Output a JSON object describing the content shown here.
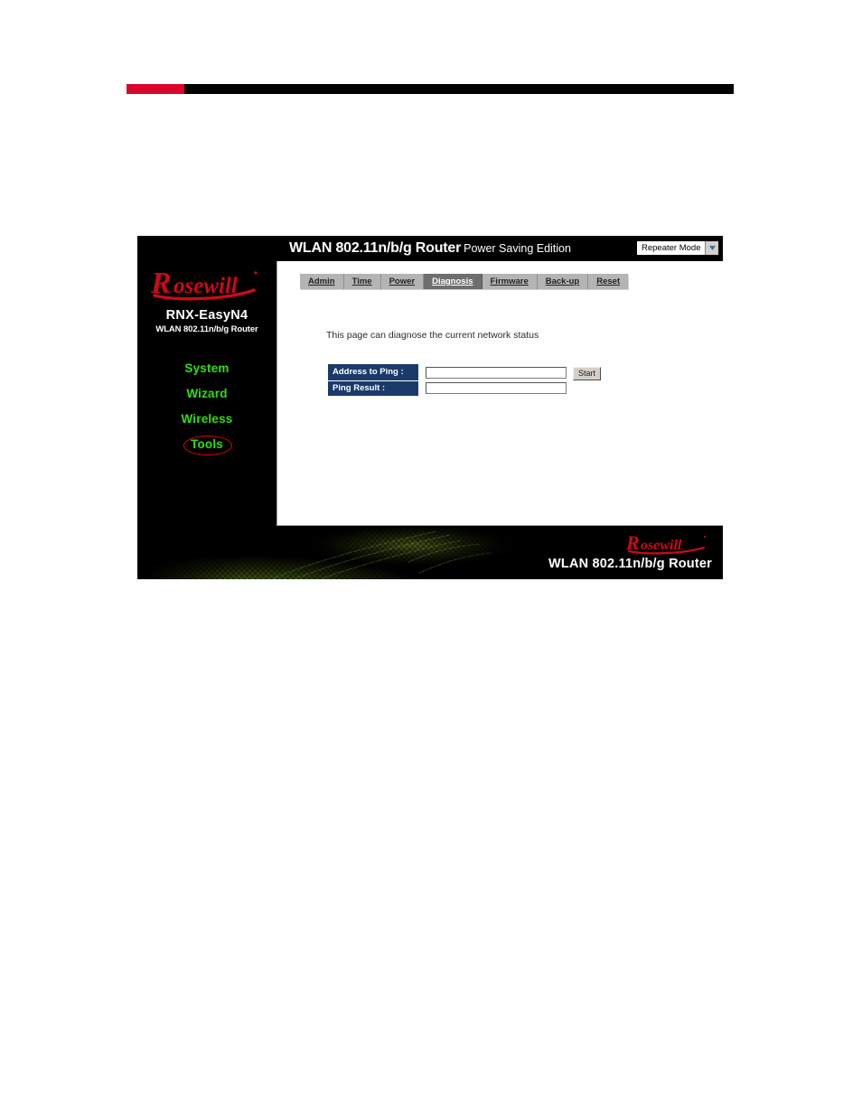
{
  "document": {
    "header_rule": {
      "accent_color": "#d9052b",
      "bar_color": "#000000"
    }
  },
  "router_ui": {
    "titlebar": {
      "title_main": "WLAN 802.11n/b/g Router",
      "title_sub": "Power Saving Edition",
      "mode_select": {
        "selected": "Repeater Mode",
        "options": [
          "Repeater Mode"
        ]
      }
    },
    "sidebar": {
      "brand": "Rosewill",
      "model_name": "RNX-EasyN4",
      "model_sub": "WLAN 802.11n/b/g Router",
      "nav_items": [
        {
          "label": "System",
          "marked": false
        },
        {
          "label": "Wizard",
          "marked": false
        },
        {
          "label": "Wireless",
          "marked": false
        },
        {
          "label": "Tools",
          "marked": true
        }
      ],
      "nav_color": "#33dd11",
      "marker_color": "#ee0000"
    },
    "content": {
      "tabs": [
        {
          "label": "Admin",
          "active": false
        },
        {
          "label": "Time",
          "active": false
        },
        {
          "label": "Power",
          "active": false
        },
        {
          "label": "Diagnosis",
          "active": true
        },
        {
          "label": "Firmware",
          "active": false
        },
        {
          "label": "Back-up",
          "active": false
        },
        {
          "label": "Reset",
          "active": false
        }
      ],
      "description": "This page can diagnose the current network status",
      "form": {
        "label_bg": "#1a3a6b",
        "rows": [
          {
            "label": "Address to Ping :",
            "value": "",
            "placeholder": ""
          },
          {
            "label": "Ping Result :",
            "value": "",
            "placeholder": ""
          }
        ],
        "start_button": "Start"
      }
    },
    "footer": {
      "brand": "Rosewill",
      "caption": "WLAN 802.11n/b/g Router"
    }
  }
}
